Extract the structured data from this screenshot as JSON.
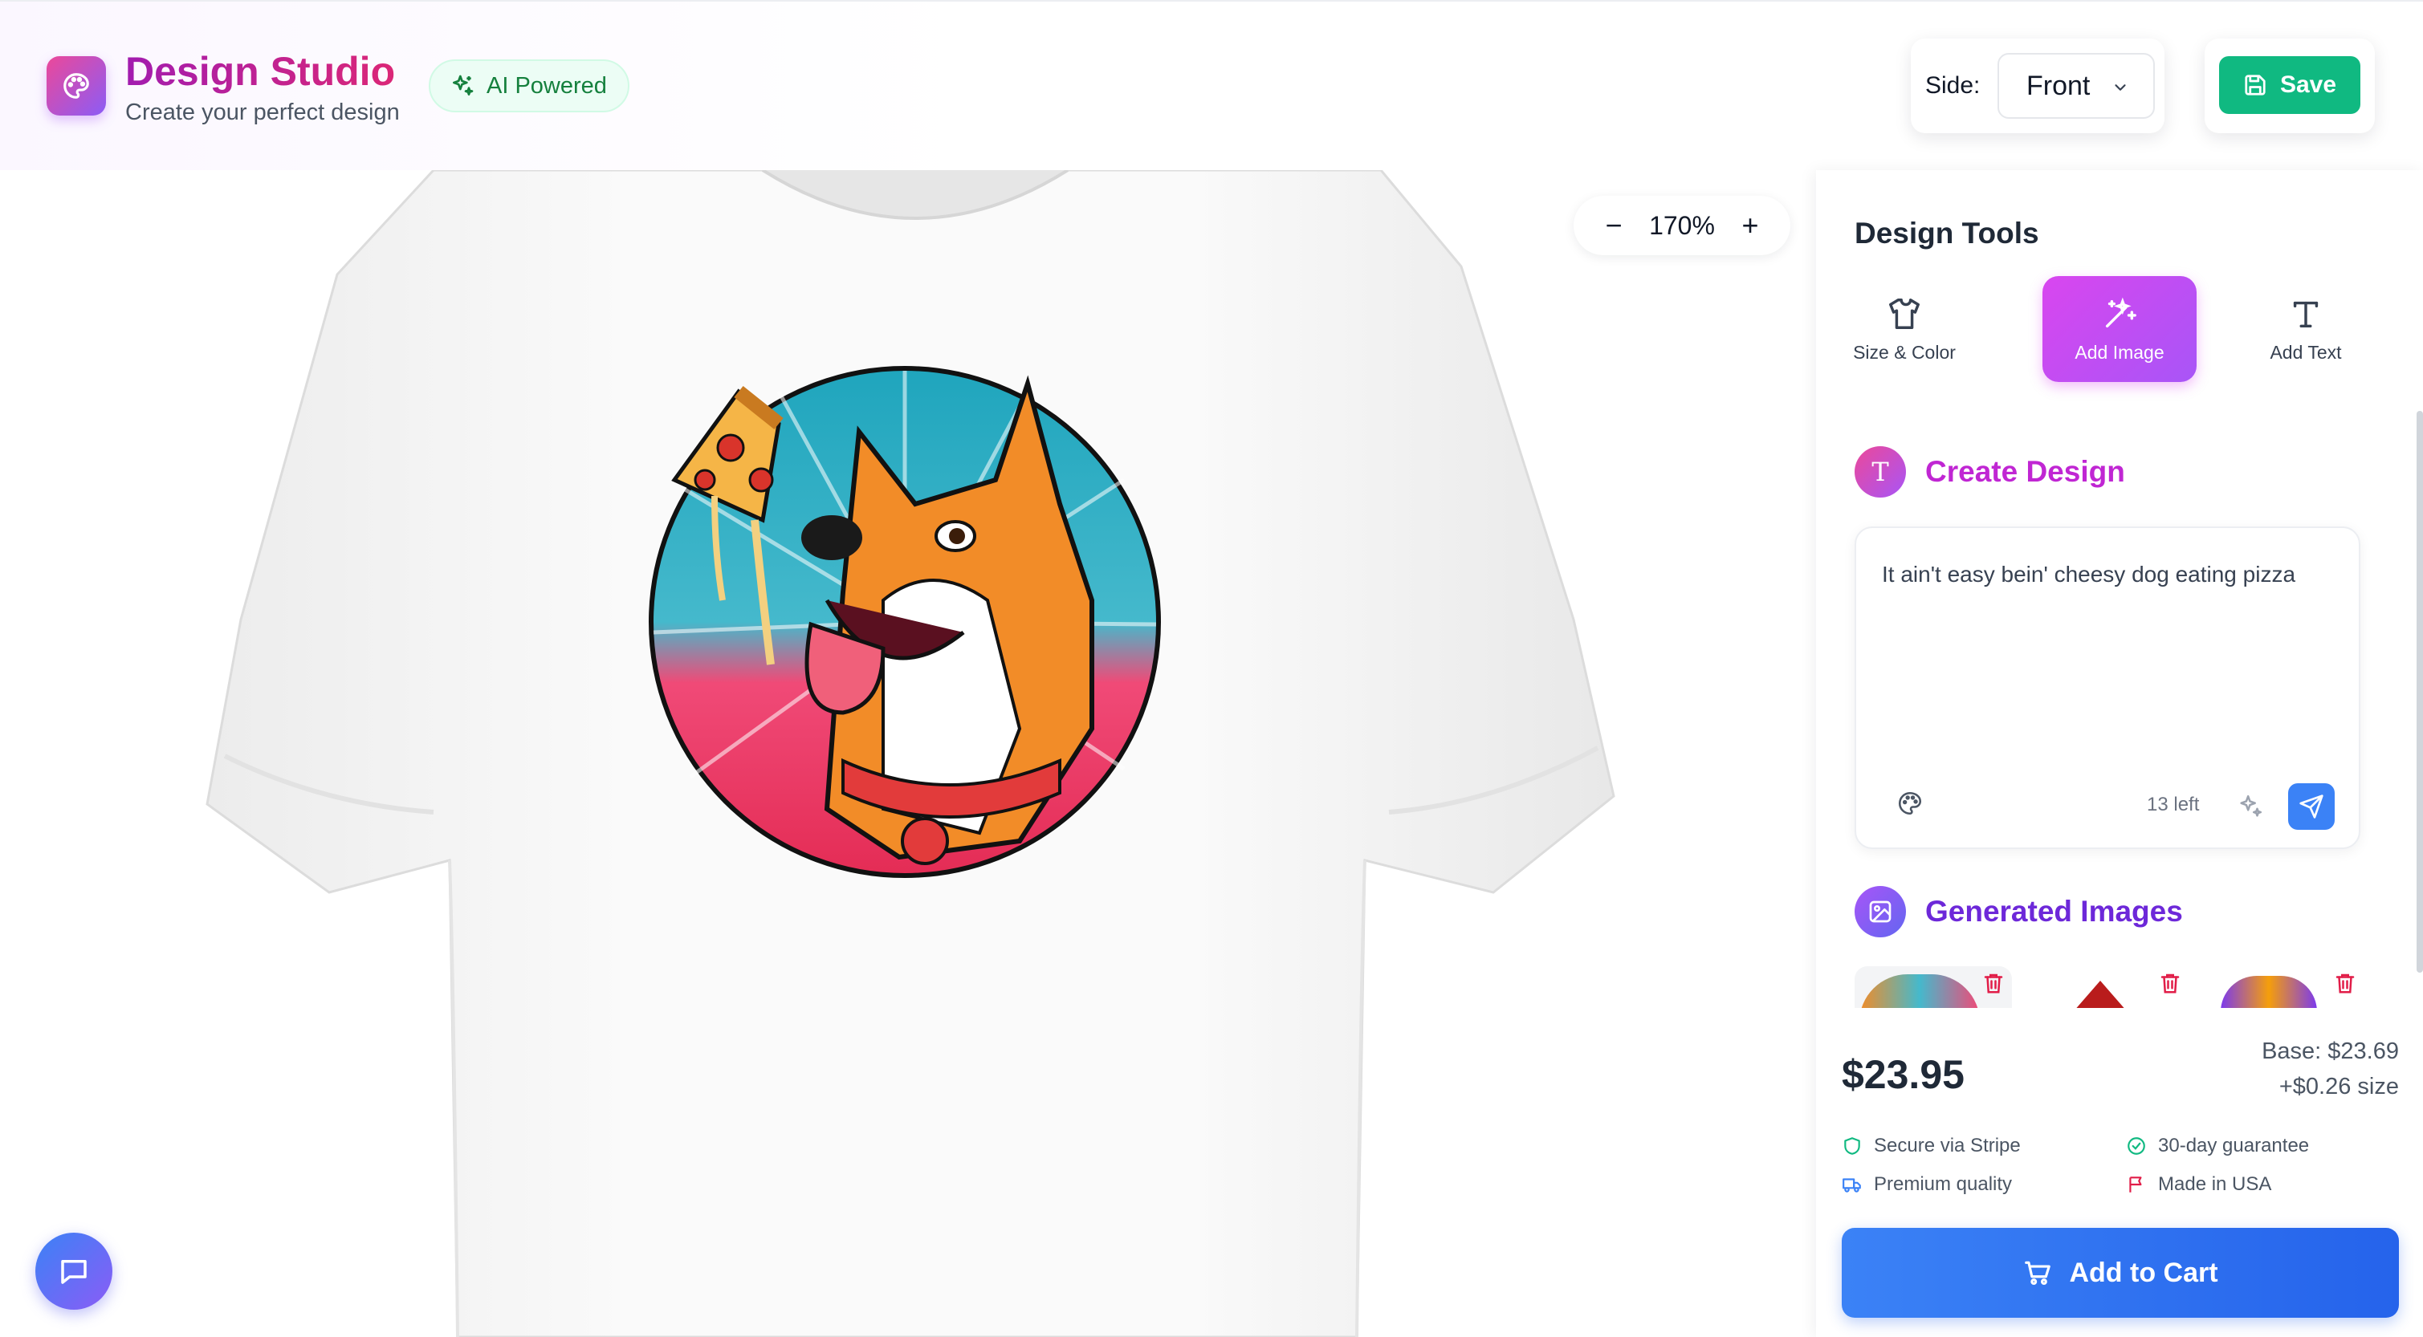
{
  "header": {
    "brand_title": "Design Studio",
    "brand_subtitle": "Create your perfect design",
    "ai_badge": "AI Powered",
    "side_label": "Side:",
    "side_value": "Front",
    "save_label": "Save"
  },
  "canvas": {
    "zoom_level": "170%",
    "zoom_out_label": "−",
    "zoom_in_label": "+"
  },
  "tools": {
    "title": "Design Tools",
    "items": [
      {
        "label": "Size & Color",
        "icon": "shirt-icon",
        "active": false
      },
      {
        "label": "Add Image",
        "icon": "magic-wand-icon",
        "active": true
      },
      {
        "label": "Add Text",
        "icon": "text-icon",
        "active": false
      }
    ]
  },
  "create": {
    "title": "Create Design",
    "icon_letter": "T",
    "prompt": "It ain't easy bein' cheesy dog eating pizza",
    "chars_left": "13 left"
  },
  "generated": {
    "title": "Generated Images",
    "count_visible": 3
  },
  "pricing": {
    "price": "$23.95",
    "base": "Base: $23.69",
    "size_extra": "+$0.26 size",
    "features": [
      {
        "label": "Secure via Stripe",
        "icon": "shield-icon"
      },
      {
        "label": "30-day guarantee",
        "icon": "check-circle-icon"
      },
      {
        "label": "Premium quality",
        "icon": "truck-icon"
      },
      {
        "label": "Made in USA",
        "icon": "flag-icon"
      }
    ],
    "cart_label": "Add to Cart"
  },
  "colors": {
    "brand_gradient_start": "#ec4899",
    "brand_gradient_end": "#8b5cf6",
    "save": "#10b981",
    "active_tool": "#d946ef",
    "cart": "#2563eb",
    "generated_title": "#6d28d9"
  }
}
